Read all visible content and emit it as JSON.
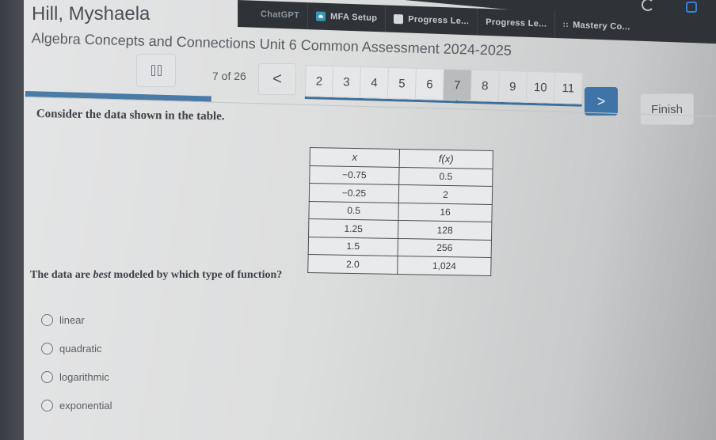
{
  "browser": {
    "bookmarks": [
      {
        "label": "ChatGPT",
        "icon": "chatgpt-icon",
        "partial": true
      },
      {
        "label": "MFA Setup",
        "icon": "cloud-icon"
      },
      {
        "label": "Progress Le...",
        "icon": "chart-icon"
      },
      {
        "label": "Progress Le...",
        "icon": ""
      },
      {
        "label": "Mastery Co...",
        "icon": "dots-icon"
      }
    ]
  },
  "header": {
    "student_name": "Hill, Myshaela",
    "assessment_title": "Algebra Concepts and Connections Unit 6 Common Assessment 2024-2025"
  },
  "toolbar": {
    "pause_icon": "pause-icon",
    "question_count": "7 of 26",
    "prev_label": "<",
    "next_label": ">",
    "finish_label": "Finish",
    "question_tabs": [
      "2",
      "3",
      "4",
      "5",
      "6",
      "7",
      "8",
      "9",
      "10",
      "11"
    ],
    "current_question": "7",
    "accent_color": "#3f74a8"
  },
  "progress": {
    "current": 7,
    "total": 26,
    "fraction": 0.27
  },
  "question": {
    "prompt": "Consider the data shown in the table.",
    "table": {
      "headers": [
        "x",
        "f(x)"
      ],
      "rows": [
        [
          "−0.75",
          "0.5"
        ],
        [
          "−0.25",
          "2"
        ],
        [
          "0.5",
          "16"
        ],
        [
          "1.25",
          "128"
        ],
        [
          "1.5",
          "256"
        ],
        [
          "2.0",
          "1,024"
        ]
      ]
    },
    "text_before": "The data are ",
    "text_emphasis": "best",
    "text_after": " modeled by which type of function?",
    "choices": [
      "linear",
      "quadratic",
      "logarithmic",
      "exponential"
    ],
    "selected": null
  }
}
